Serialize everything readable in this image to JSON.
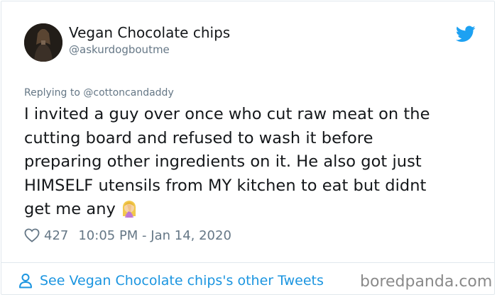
{
  "tweet": {
    "display_name": "Vegan Chocolate chips",
    "handle": "@askurdogboutme",
    "replying_to": "Replying to @cottoncandaddy",
    "text_lines": [
      "I invited a guy over once who cut raw meat on the",
      "cutting board and refused to wash it before",
      "preparing other ingredients on it. He also got just",
      "HIMSELF utensils from MY kitchen to eat but didnt",
      "get me any"
    ],
    "emoji": "woman-facepalming-emoji",
    "like_count": "427",
    "timestamp": "10:05 PM - Jan 14, 2020",
    "see_more": "See Vegan Chocolate chips's other Tweets"
  },
  "watermark": "boredpanda.com",
  "icons": {
    "bird": "twitter-bird-icon",
    "heart": "heart-icon",
    "user": "user-icon"
  },
  "colors": {
    "link_blue": "#1b95e0",
    "twitter_blue": "#1da1f2",
    "secondary_text": "#657786",
    "primary_text": "#14171a",
    "border": "#e1e8ed"
  }
}
